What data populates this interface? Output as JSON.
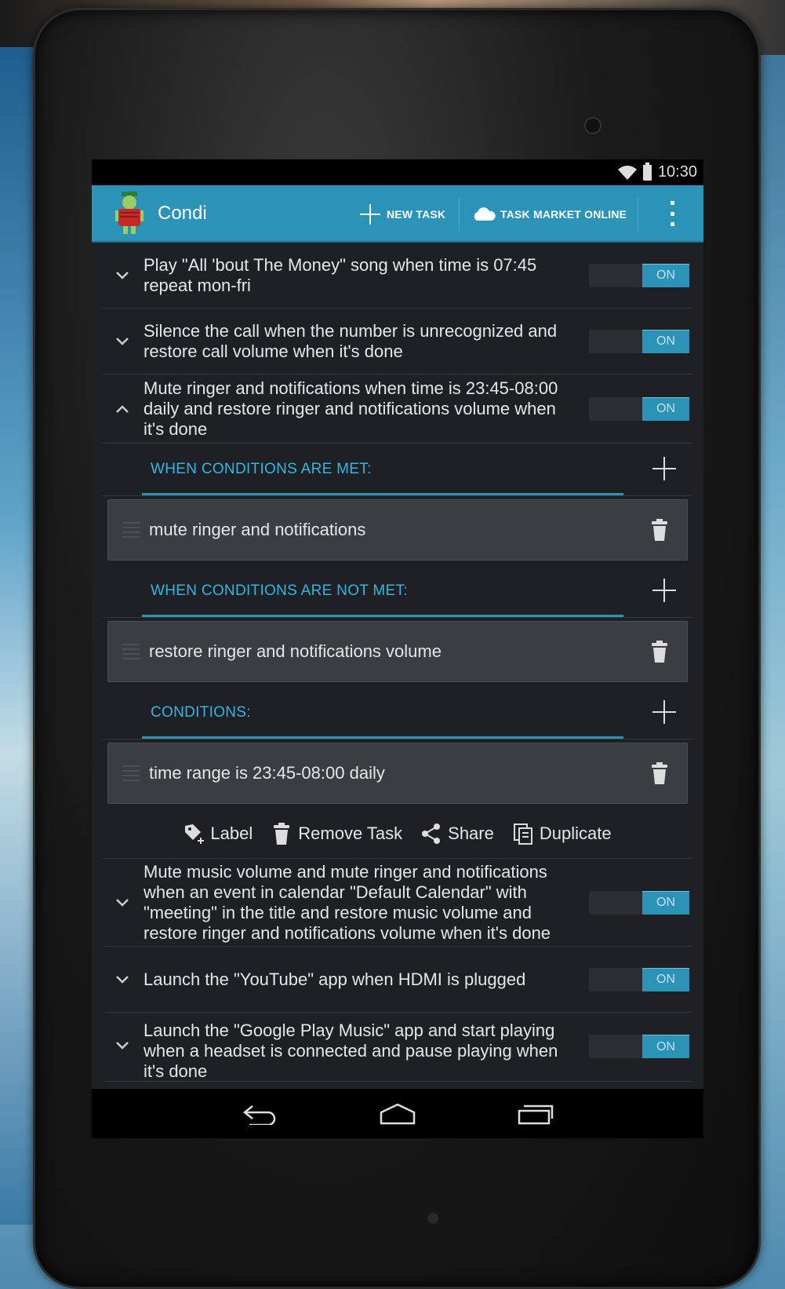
{
  "status_bar": {
    "time": "10:30"
  },
  "action_bar": {
    "title": "Condi",
    "new_task": "NEW TASK",
    "task_market": "TASK MARKET ONLINE"
  },
  "toggle_label": "ON",
  "tasks": [
    {
      "text": "Play \"All 'bout The Money\" song when time is 07:45 repeat  mon-fri",
      "expanded": false
    },
    {
      "text": "Silence the call when the number is unrecognized and restore call volume when it's done",
      "expanded": false
    },
    {
      "text": "Mute ringer and notifications when time is 23:45-08:00 daily and restore ringer and notifications volume when it's done",
      "expanded": true
    },
    {
      "text": "Mute music volume and mute ringer and notifications when an event in calendar \"Default Calendar\" with \"meeting\" in the title and restore music volume and restore ringer and notifications volume when it's done",
      "expanded": false
    },
    {
      "text": "Launch the \"YouTube\" app when HDMI is plugged",
      "expanded": false
    },
    {
      "text": "Launch the \"Google Play Music\" app and start playing when a headset is connected and pause playing when it's done",
      "expanded": false
    }
  ],
  "expanded": {
    "met_header": "WHEN CONDITIONS ARE MET:",
    "met_action": "mute ringer and notifications",
    "not_met_header": "WHEN CONDITIONS ARE NOT MET:",
    "not_met_action": "restore ringer and notifications volume",
    "conditions_header": "CONDITIONS:",
    "condition": "time range is 23:45-08:00 daily"
  },
  "task_toolbar": {
    "label": "Label",
    "remove": "Remove Task",
    "share": "Share",
    "duplicate": "Duplicate"
  },
  "colors": {
    "accent": "#2b93b7",
    "accent_text": "#33b5e5",
    "list_bg": "#1e2023"
  }
}
